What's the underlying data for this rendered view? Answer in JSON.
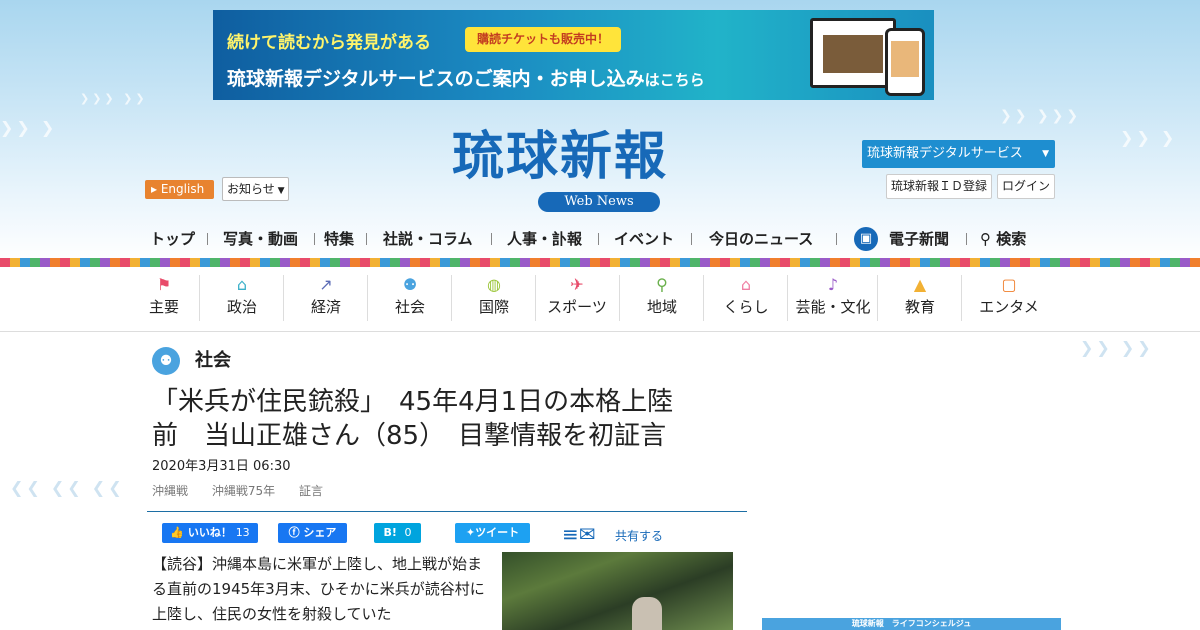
{
  "banner": {
    "line1": "続けて読むから発見がある",
    "ticket": "購読チケットも販売中！",
    "line2_main": "琉球新報デジタルサービスのご案内・お申し込み",
    "line2_small": "はこちら"
  },
  "header": {
    "logo": "琉球新報",
    "webnews": "Web News",
    "english": "English",
    "notice": "お知らせ",
    "digital_service": "琉球新報デジタルサービス",
    "id_register": "琉球新報ＩＤ登録",
    "login": "ログイン"
  },
  "global_nav": [
    "トップ",
    "写真・動画",
    "特集",
    "社説・コラム",
    "人事・訃報",
    "イベント",
    "今日のニュース",
    "電子新聞",
    "検索"
  ],
  "category_nav": [
    {
      "label": "主要",
      "icon": "flag-icon",
      "color": "#e84b6a"
    },
    {
      "label": "政治",
      "icon": "building-icon",
      "color": "#3bb0c9"
    },
    {
      "label": "経済",
      "icon": "chart-icon",
      "color": "#5b6bb5"
    },
    {
      "label": "社会",
      "icon": "people-icon",
      "color": "#4aa3df"
    },
    {
      "label": "国際",
      "icon": "globe-icon",
      "color": "#9cc63a"
    },
    {
      "label": "スポーツ",
      "icon": "runner-icon",
      "color": "#e84b6a"
    },
    {
      "label": "地域",
      "icon": "pin-icon",
      "color": "#6ab04c"
    },
    {
      "label": "くらし",
      "icon": "house-icon",
      "color": "#ef7fa3"
    },
    {
      "label": "芸能・文化",
      "icon": "sanshin-icon",
      "color": "#9a5bc8"
    },
    {
      "label": "教育",
      "icon": "graduation-icon",
      "color": "#f2b134"
    },
    {
      "label": "エンタメ",
      "icon": "tv-icon",
      "color": "#f07f2d"
    }
  ],
  "article": {
    "section": "社会",
    "title_line1": "「米兵が住民銃殺」　45年4月1日の本格上陸",
    "title_line2": "前　当山正雄さん（85）　目撃情報を初証言",
    "date": "2020年3月31日 06:30",
    "tags": [
      "沖縄戦",
      "沖縄戦75年",
      "証言"
    ],
    "body": "【読谷】沖縄本島に米軍が上陸し、地上戦が始まる直前の1945年3月末、ひそかに米兵が読谷村に上陸し、住民の女性を射殺していた"
  },
  "share": {
    "like": "いいね！",
    "like_count": "13",
    "fb_share": "シェア",
    "hatena": "B!",
    "hatena_count": "0",
    "tweet": "ツイート",
    "share_label": "共有する"
  },
  "sidebar": {
    "concierge": "琉球新報　ライフコンシェルジュ"
  }
}
